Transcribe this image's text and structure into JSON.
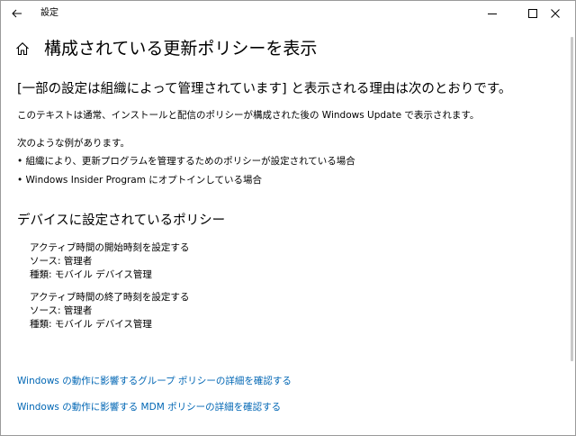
{
  "window": {
    "title": "設定"
  },
  "header": {
    "title": "構成されている更新ポリシーを表示"
  },
  "intro": {
    "heading": "[一部の設定は組織によって管理されています] と表示される理由は次のとおりです。",
    "description": "このテキストは通常、インストールと配信のポリシーが構成された後の Windows Update で表示されます。",
    "examples_label": "次のような例があります。",
    "bullets": [
      "• 組織により、更新プログラムを管理するためのポリシーが設定されている場合",
      "• Windows Insider Program にオプトインしている場合"
    ]
  },
  "policies": {
    "heading": "デバイスに設定されているポリシー",
    "items": [
      {
        "name": "アクティブ時間の開始時刻を設定する",
        "source": "ソース: 管理者",
        "type": "種類: モバイル デバイス管理"
      },
      {
        "name": "アクティブ時間の終了時刻を設定する",
        "source": "ソース: 管理者",
        "type": "種類: モバイル デバイス管理"
      }
    ]
  },
  "links": {
    "group_policy": "Windows の動作に影響するグループ ポリシーの詳細を確認する",
    "mdm_policy": "Windows の動作に影響する MDM ポリシーの詳細を確認する"
  },
  "colors": {
    "link": "#0066b4",
    "text": "#000000",
    "background": "#ffffff"
  },
  "icons": {
    "back": "back-arrow-icon",
    "home": "home-icon",
    "minimize": "minimize-icon",
    "maximize": "maximize-icon",
    "close": "close-icon"
  }
}
